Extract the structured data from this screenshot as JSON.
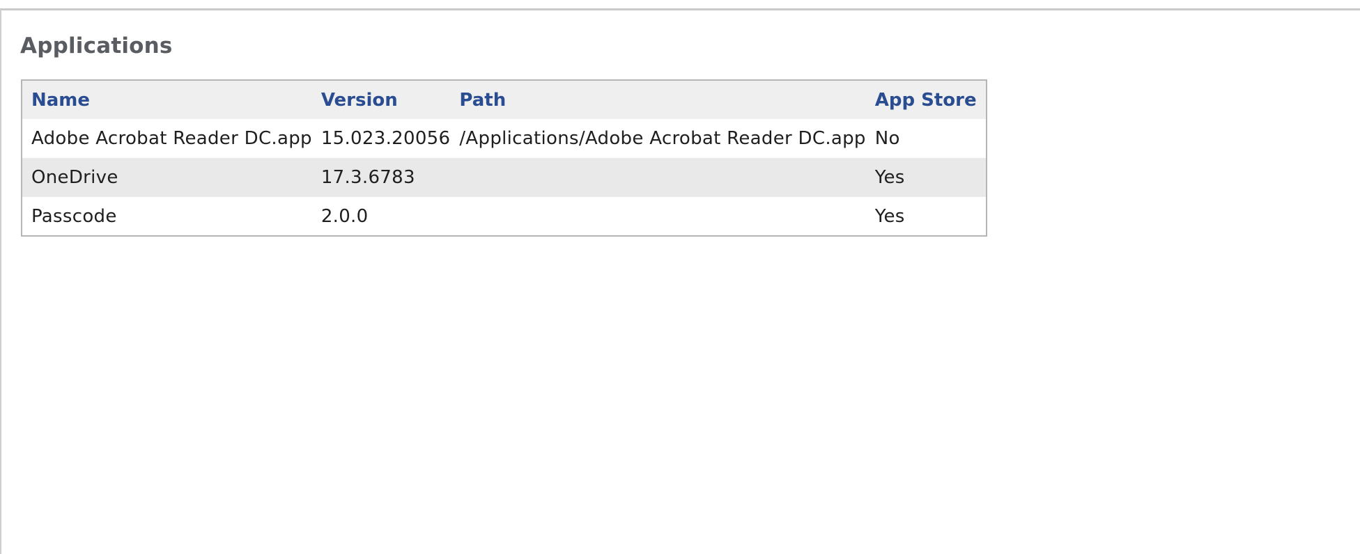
{
  "section": {
    "title": "Applications"
  },
  "table": {
    "columns": [
      "Name",
      "Version",
      "Path",
      "App Store"
    ],
    "rows": [
      [
        "Adobe Acrobat Reader DC.app",
        "15.023.20056",
        "/Applications/Adobe Acrobat Reader DC.app",
        "No"
      ],
      [
        "OneDrive",
        "17.3.6783",
        "",
        "Yes"
      ],
      [
        "Passcode",
        "2.0.0",
        "",
        "Yes"
      ]
    ]
  },
  "colors": {
    "header_text": "#2a4d91",
    "title_text": "#595c61",
    "header_bg": "#efefef",
    "alt_row_bg": "#e9e9e9"
  }
}
